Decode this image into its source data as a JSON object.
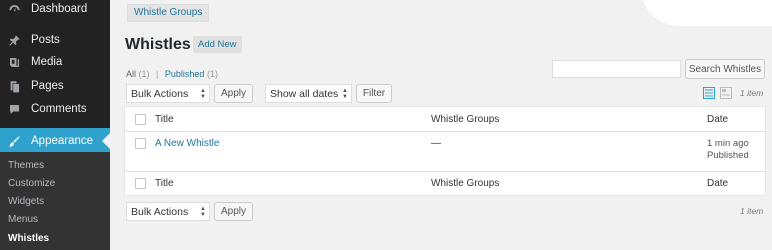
{
  "sidebar": {
    "items": [
      {
        "label": "Dashboard",
        "icon": "dashboard-icon"
      },
      {
        "label": "Posts",
        "icon": "pin-icon"
      },
      {
        "label": "Media",
        "icon": "media-icon"
      },
      {
        "label": "Pages",
        "icon": "pages-icon"
      },
      {
        "label": "Comments",
        "icon": "comments-icon"
      },
      {
        "label": "Appearance",
        "icon": "brush-icon"
      }
    ],
    "submenu": [
      "Themes",
      "Customize",
      "Widgets",
      "Menus",
      "Whistles"
    ]
  },
  "screen_options": "Whistle Groups",
  "header": {
    "title": "Whistles",
    "add_new": "Add New"
  },
  "filters": {
    "all_label": "All",
    "all_count": "(1)",
    "published_label": "Published",
    "published_count": "(1)",
    "separator": "|"
  },
  "search": {
    "button": "Search Whistles",
    "value": ""
  },
  "tablenav_top": {
    "bulk": "Bulk Actions",
    "apply": "Apply",
    "dates": "Show all dates",
    "filter": "Filter",
    "items": "1 item"
  },
  "table": {
    "columns": [
      "Title",
      "Whistle Groups",
      "Date"
    ],
    "rows": [
      {
        "title": "A New Whistle",
        "groups": "—",
        "date": "1 min ago",
        "status": "Published"
      }
    ]
  },
  "tablenav_bottom": {
    "bulk": "Bulk Actions",
    "apply": "Apply",
    "items": "1 item"
  },
  "colors": {
    "accent": "#2ea2cc",
    "link": "#21759b",
    "sidebar": "#222222"
  }
}
